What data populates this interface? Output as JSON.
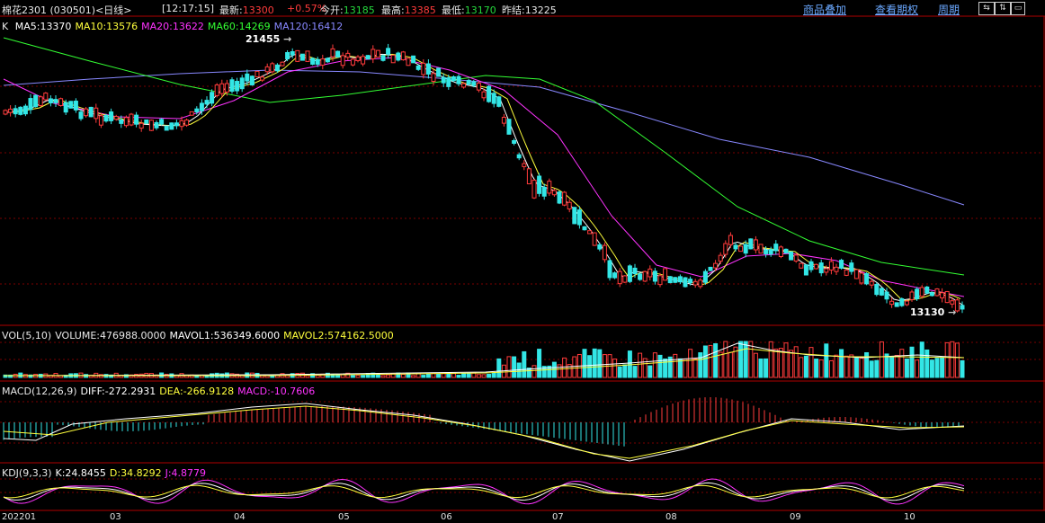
{
  "header": {
    "title": "棉花2301 (030501)<日线>",
    "time": "[12:17:15]",
    "quote": [
      {
        "label": "最新:",
        "value": "13300",
        "color": "#ff3b3b"
      },
      {
        "label": "",
        "value": "+0.57%",
        "color": "#ff3b3b"
      },
      {
        "label": "今开:",
        "value": "13185",
        "color": "#25d73c"
      },
      {
        "label": "最高:",
        "value": "13385",
        "color": "#ff3b3b"
      },
      {
        "label": "最低:",
        "value": "13170",
        "color": "#25d73c"
      },
      {
        "label": "昨结:",
        "value": "13225",
        "color": "#e8e8e8"
      }
    ],
    "links": [
      "商品叠加",
      "查看期权",
      "周期"
    ],
    "nav_icons": [
      "arrow-left-right-icon",
      "arrow-up-down-icon",
      "minimize-panel-icon"
    ]
  },
  "main_chart": {
    "prefix": "K",
    "ma": [
      {
        "text": "MA5:13370",
        "color": "#ffffff"
      },
      {
        "text": "MA10:13576",
        "color": "#ffff3c"
      },
      {
        "text": "MA20:13622",
        "color": "#ff33ff"
      },
      {
        "text": "MA60:14269",
        "color": "#33ff33"
      },
      {
        "text": "MA120:16412",
        "color": "#8888ff"
      }
    ],
    "high_label": "21455",
    "low_label": "13130"
  },
  "volume_panel": {
    "items": [
      {
        "text": "VOL(5,10)",
        "color": "#e8e8e8"
      },
      {
        "text": "VOLUME:476988.0000",
        "color": "#e8e8e8"
      },
      {
        "text": "MAVOL1:536349.6000",
        "color": "#ffffff"
      },
      {
        "text": "MAVOL2:574162.5000",
        "color": "#ffff3c"
      }
    ]
  },
  "macd_panel": {
    "items": [
      {
        "text": "MACD(12,26,9)",
        "color": "#e8e8e8"
      },
      {
        "text": "DIFF:-272.2931",
        "color": "#ffffff"
      },
      {
        "text": "DEA:-266.9128",
        "color": "#ffff3c"
      },
      {
        "text": "MACD:-10.7606",
        "color": "#ff33ff"
      }
    ]
  },
  "kdj_panel": {
    "items": [
      {
        "text": "KDJ(9,3,3)",
        "color": "#e8e8e8"
      },
      {
        "text": "K:24.8455",
        "color": "#ffffff"
      },
      {
        "text": "D:34.8292",
        "color": "#ffff3c"
      },
      {
        "text": "J:4.8779",
        "color": "#ff33ff"
      }
    ]
  },
  "x_axis": [
    "202201",
    "03",
    "04",
    "05",
    "06",
    "07",
    "08",
    "09",
    "10"
  ],
  "colors": {
    "up": "#ff3b3b",
    "down": "#33e6e6",
    "grid": "#7a0000",
    "border": "#b00000",
    "link": "#6aa8ff"
  }
}
